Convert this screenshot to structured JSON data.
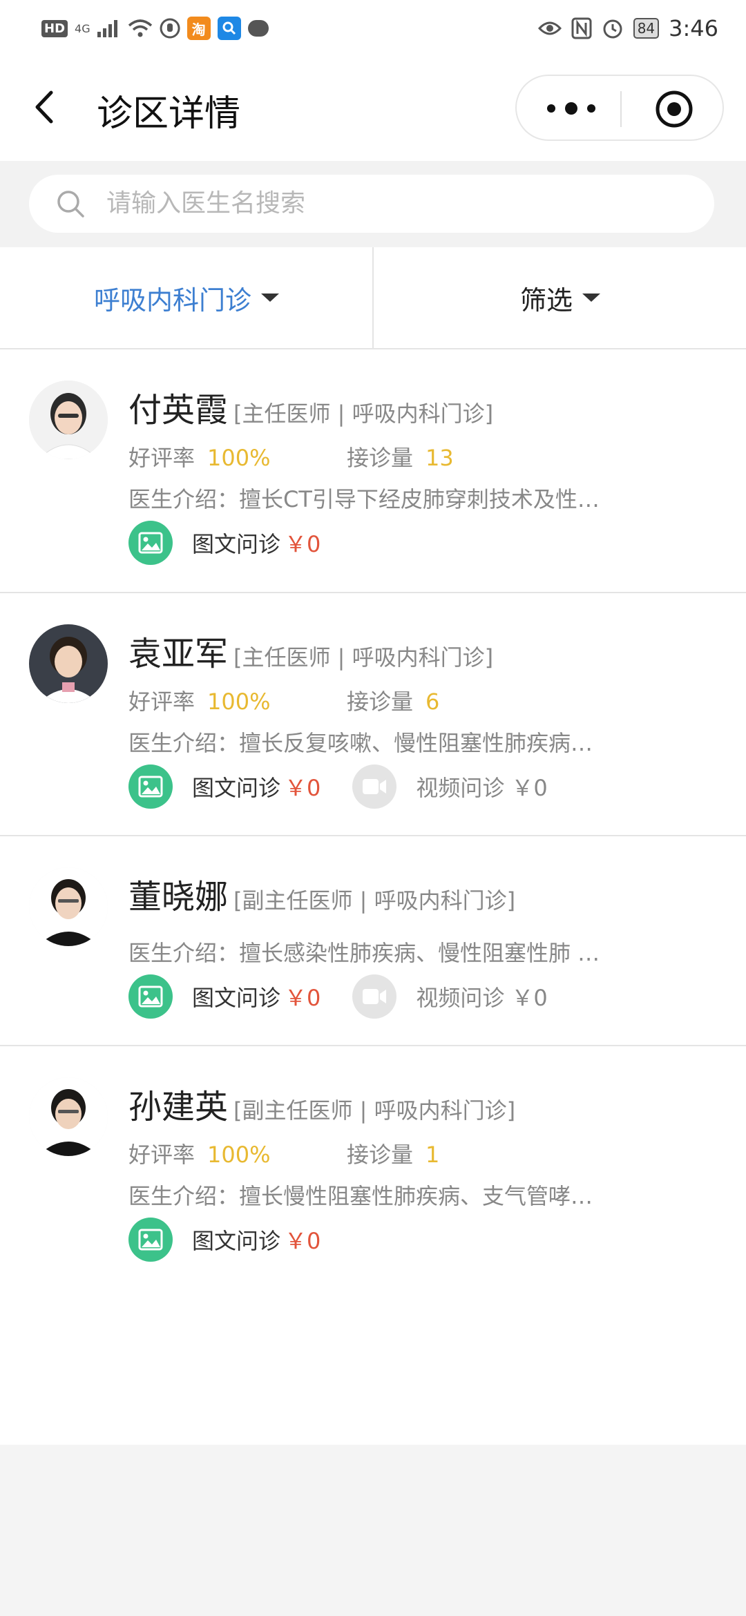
{
  "status_bar": {
    "hd": "HD",
    "net": "4G",
    "app_taobao": "淘",
    "battery": "84",
    "time": "3:46"
  },
  "header": {
    "title": "诊区详情"
  },
  "search": {
    "placeholder": "请输入医生名搜索"
  },
  "filters": {
    "department": "呼吸内科门诊",
    "filter": "筛选",
    "active_color": "#3d7fd1"
  },
  "colors": {
    "accent_green": "#3cc28a",
    "stat_yellow": "#e8b931",
    "price_red": "#e2543b"
  },
  "doctors": [
    {
      "name": "付英霞",
      "tag": "[主任医师 | 呼吸内科门诊]",
      "rating_label": "好评率",
      "rating": "100%",
      "visits_label": "接诊量",
      "visits": "13",
      "intro": "医生介绍：擅长CT引导下经皮肺穿刺技术及性…",
      "text_consult": "图文问诊",
      "text_price": "￥0"
    },
    {
      "name": "袁亚军",
      "tag": "[主任医师 | 呼吸内科门诊]",
      "rating_label": "好评率",
      "rating": "100%",
      "visits_label": "接诊量",
      "visits": "6",
      "intro": "医生介绍：擅长反复咳嗽、慢性阻塞性肺疾病…",
      "text_consult": "图文问诊",
      "text_price": "￥0",
      "video_consult": "视频问诊",
      "video_price": "￥0"
    },
    {
      "name": "董晓娜",
      "tag": "[副主任医师 | 呼吸内科门诊]",
      "intro": "医生介绍：擅长感染性肺疾病、慢性阻塞性肺 …",
      "text_consult": "图文问诊",
      "text_price": "￥0",
      "video_consult": "视频问诊",
      "video_price": "￥0"
    },
    {
      "name": "孙建英",
      "tag": "[副主任医师 | 呼吸内科门诊]",
      "rating_label": "好评率",
      "rating": "100%",
      "visits_label": "接诊量",
      "visits": "1",
      "intro": "医生介绍：擅长慢性阻塞性肺疾病、支气管哮…",
      "text_consult": "图文问诊",
      "text_price": "￥0"
    }
  ]
}
